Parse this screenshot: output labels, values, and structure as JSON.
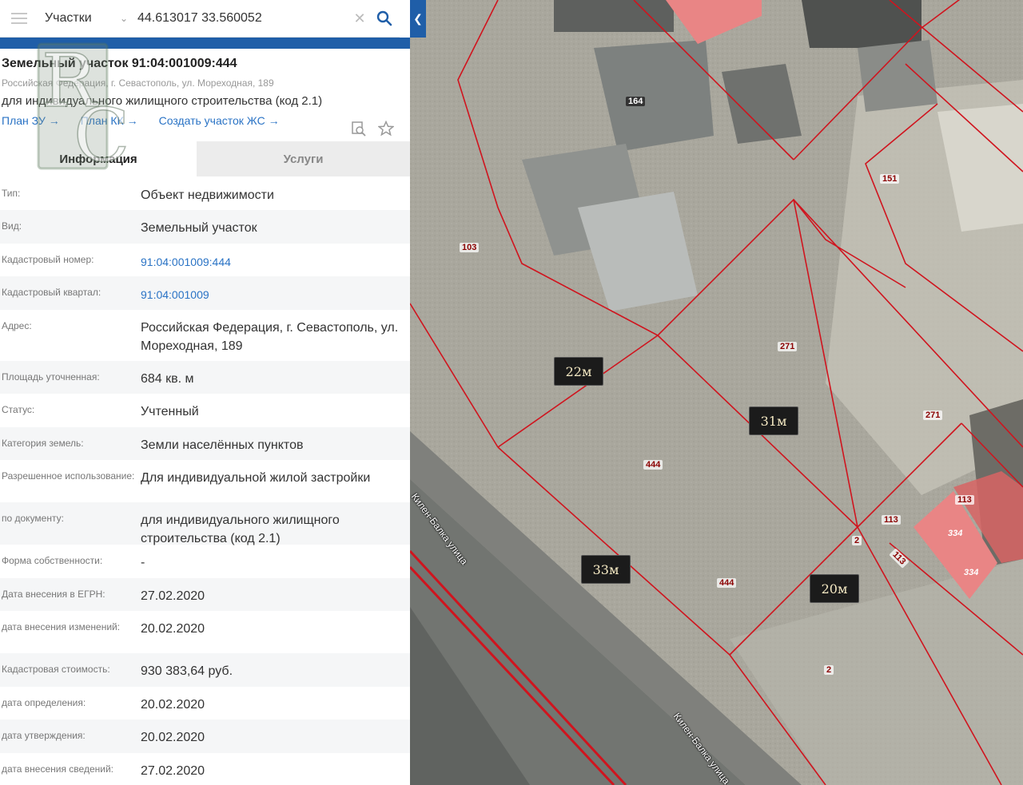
{
  "search": {
    "select_value": "Участки",
    "query": "44.613017 33.560052"
  },
  "parcel": {
    "title": "Земельный участок 91:04:001009:444",
    "address_small": "Российская Федерация, г. Севастополь, ул. Мореходная, 189",
    "usage": "для индивидуального жилищного строительства (код 2.1)",
    "links": [
      "План ЗУ →",
      "План КК →",
      "Создать участок ЖС →"
    ]
  },
  "tabs": [
    "Информация",
    "Услуги"
  ],
  "info_rows": [
    {
      "label": "Тип:",
      "value": "Объект недвижимости",
      "link": false
    },
    {
      "label": "Вид:",
      "value": "Земельный участок",
      "link": false
    },
    {
      "label": "Кадастровый номер:",
      "value": "91:04:001009:444",
      "link": true
    },
    {
      "label": "Кадастровый квартал:",
      "value": "91:04:001009",
      "link": true
    },
    {
      "label": "Адрес:",
      "value": "Российская Федерация, г. Севастополь, ул. Мореходная, 189",
      "link": false
    },
    {
      "label": "Площадь уточненная:",
      "value": "684 кв. м",
      "link": false
    },
    {
      "label": "Статус:",
      "value": "Учтенный",
      "link": false
    },
    {
      "label": "Категория земель:",
      "value": "Земли населённых пунктов",
      "link": false
    },
    {
      "label": "Разрешенное использование:",
      "value": "Для индивидуальной жилой застройки",
      "link": false
    },
    {
      "label": "по документу:",
      "value": "для индивидуального жилищного строительства (код 2.1)",
      "link": false
    },
    {
      "label": "Форма собственности:",
      "value": "-",
      "link": false
    },
    {
      "label": "Дата внесения в ЕГРН:",
      "value": "27.02.2020",
      "link": false
    },
    {
      "label": "дата внесения изменений:",
      "value": "20.02.2020",
      "link": false
    },
    {
      "label": "Кадастровая стоимость:",
      "value": "930 383,64 руб.",
      "link": false
    },
    {
      "label": "дата определения:",
      "value": "20.02.2020",
      "link": false
    },
    {
      "label": "дата утверждения:",
      "value": "20.02.2020",
      "link": false
    },
    {
      "label": "дата внесения сведений:",
      "value": "27.02.2020",
      "link": false
    }
  ],
  "map": {
    "dimension_labels": [
      "22м",
      "31м",
      "33м",
      "20м"
    ],
    "parcel_numbers": [
      "164",
      "103",
      "151",
      "271",
      "271",
      "444",
      "444",
      "113",
      "113",
      "113",
      "2",
      "2",
      "334",
      "334"
    ],
    "street": "Килен-Балка улица"
  },
  "colors": {
    "accent": "#1f5ea8",
    "link": "#2a73c5",
    "parcel_line": "#d0141e"
  }
}
